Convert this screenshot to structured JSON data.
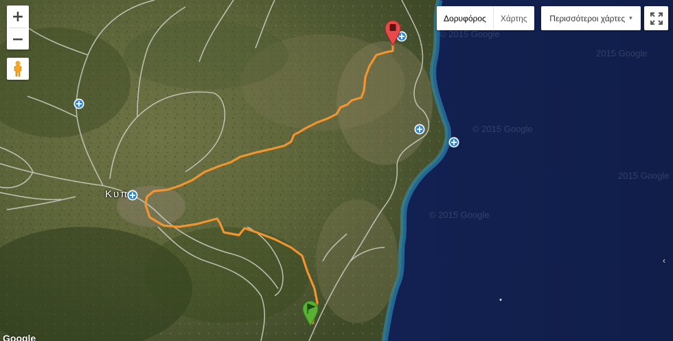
{
  "controls": {
    "zoom_in": "+",
    "zoom_out": "−",
    "pegman_icon": "pegman-icon",
    "fullscreen_icon": "fullscreen-icon"
  },
  "map_type": {
    "satellite": "Δορυφόρος",
    "map": "Χάρτης",
    "selected": "Δορυφόρος",
    "more_maps": "Περισσότεροι χάρτες",
    "more_caret": "▾"
  },
  "places": {
    "village": "Κυπ"
  },
  "watermarks": [
    "© 2015 Google",
    "2015 Google",
    "© 2015 Google",
    "© 2015 Google",
    "2015 Google"
  ],
  "attribution": "Google",
  "colors": {
    "track": "#f2962e",
    "sea_deep": "#12224f",
    "sea_shore": "#1c6fa3",
    "land": "#5e6a3c",
    "start_marker": "#5ab035",
    "end_marker": "#e84a4a",
    "waypoint": "#2a86d8"
  },
  "markers": {
    "start": "start-flag-marker",
    "end": "end-pin-marker",
    "waypoint": "waypoint-icon"
  }
}
